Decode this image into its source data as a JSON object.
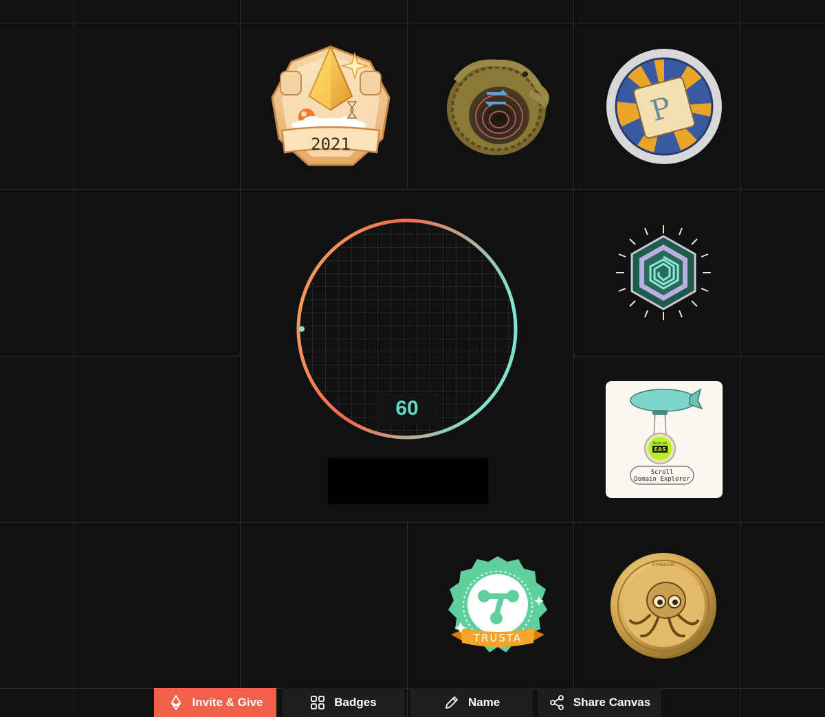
{
  "canvas": {
    "score": "60",
    "accent_color": "#f0604a",
    "ring_gradient": [
      "#f26a4f",
      "#f5b860",
      "#7fe3d2"
    ]
  },
  "badges": {
    "year_badge": {
      "icon": "ethereum-2021-badge",
      "label": "2021"
    },
    "crocodile_badge": {
      "icon": "crocodile-swap-badge"
    },
    "scroll_p_badge": {
      "icon": "scroll-p-badge"
    },
    "scroll_hex_badge": {
      "icon": "scroll-hexagon-badge"
    },
    "domain_explorer_badge": {
      "icon": "airship-eas-badge",
      "eas_label": "EAS",
      "eas_small": "build on",
      "line1": "Scroll",
      "line2": "Domain Explorer"
    },
    "trusta_badge": {
      "icon": "trusta-badge",
      "label": "TRUSTA"
    },
    "symbiosis_badge": {
      "icon": "symbiosis-octopus-coin",
      "ring_text": "SYMBIOSIS"
    }
  },
  "toolbar": {
    "invite_label": "Invite & Give",
    "badges_label": "Badges",
    "name_label": "Name",
    "share_label": "Share Canvas"
  }
}
